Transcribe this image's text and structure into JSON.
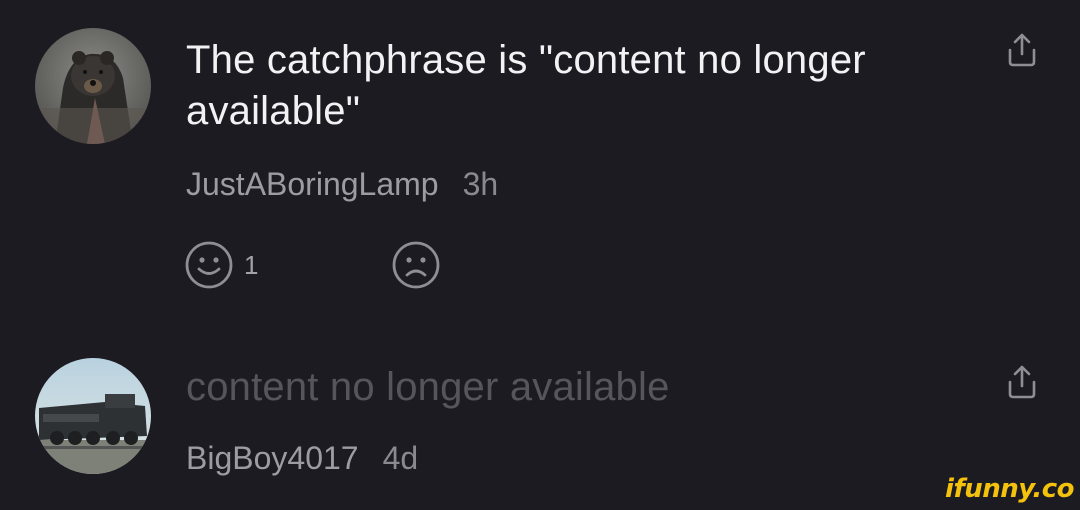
{
  "comments": [
    {
      "avatar_icon": "bear-avatar",
      "text": "The catchphrase is \"content no longer available\"",
      "author": "JustABoringLamp",
      "time": "3h",
      "like_count": "1"
    },
    {
      "avatar_icon": "locomotive-avatar",
      "text": "content no longer available",
      "author": "BigBoy4017",
      "time": "4d"
    }
  ],
  "watermark": "ifunny.co",
  "colors": {
    "background": "#1c1b21",
    "text_primary": "#f2f2f4",
    "text_removed": "#56555c",
    "meta": "#9d9ca3",
    "icon": "#8f8e95",
    "watermark": "#f4c20d"
  }
}
